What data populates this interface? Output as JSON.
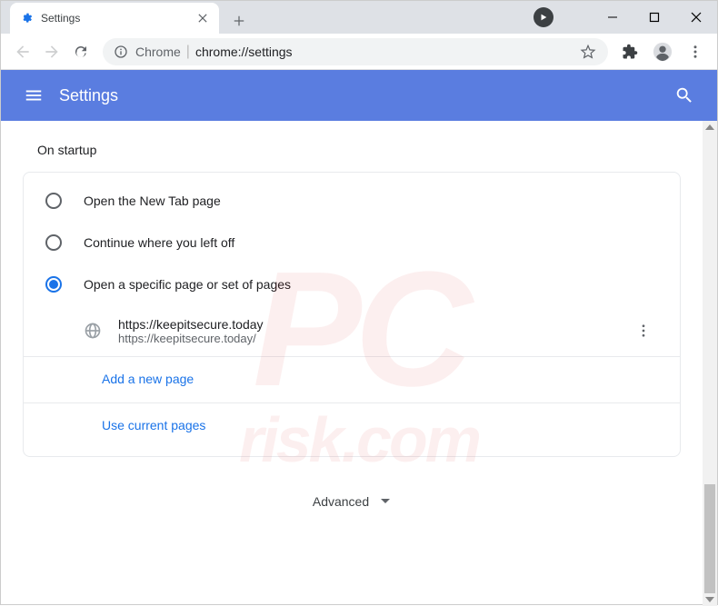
{
  "tab": {
    "title": "Settings"
  },
  "omnibox": {
    "chrome_label": "Chrome",
    "url": "chrome://settings"
  },
  "header": {
    "title": "Settings"
  },
  "section": {
    "title": "On startup"
  },
  "radio_options": {
    "new_tab": "Open the New Tab page",
    "continue": "Continue where you left off",
    "specific": "Open a specific page or set of pages"
  },
  "startup_page": {
    "name": "https://keepitsecure.today",
    "url": "https://keepitsecure.today/"
  },
  "links": {
    "add_page": "Add a new page",
    "use_current": "Use current pages"
  },
  "advanced": {
    "label": "Advanced"
  }
}
